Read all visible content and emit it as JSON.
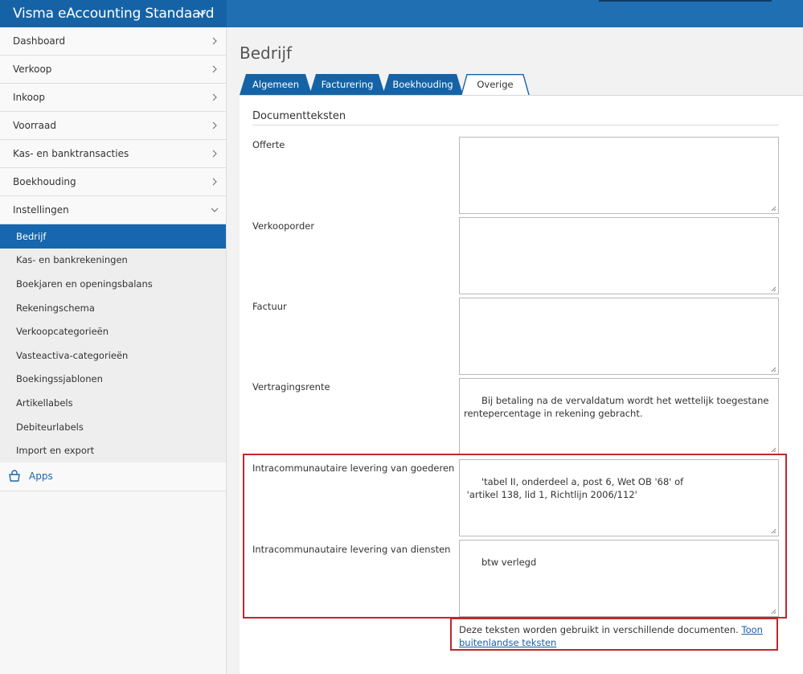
{
  "app": {
    "title": "Visma eAccounting Standaard",
    "brand_color": "#1563a6",
    "accent_color": "#1667ad",
    "highlight_color": "#c0272d"
  },
  "sidebar": {
    "items": [
      {
        "label": "Dashboard",
        "icon": "chevron-right-icon"
      },
      {
        "label": "Verkoop",
        "icon": "chevron-right-icon"
      },
      {
        "label": "Inkoop",
        "icon": "chevron-right-icon"
      },
      {
        "label": "Voorraad",
        "icon": "chevron-right-icon"
      },
      {
        "label": "Kas- en banktransacties",
        "icon": "chevron-right-icon"
      },
      {
        "label": "Boekhouding",
        "icon": "chevron-right-icon"
      },
      {
        "label": "Instellingen",
        "icon": "chevron-down-icon"
      }
    ],
    "sub_items": [
      {
        "label": "Bedrijf",
        "active": true
      },
      {
        "label": "Kas- en bankrekeningen"
      },
      {
        "label": "Boekjaren en openingsbalans"
      },
      {
        "label": "Rekeningschema"
      },
      {
        "label": "Verkoopcategorieën"
      },
      {
        "label": "Vasteactiva-categorieën"
      },
      {
        "label": "Boekingssjablonen"
      },
      {
        "label": "Artikellabels"
      },
      {
        "label": "Debiteurlabels"
      },
      {
        "label": "Import en export"
      }
    ],
    "apps_label": "Apps",
    "apps_icon": "shopping-basket-icon"
  },
  "main": {
    "page_title": "Bedrijf",
    "tabs": [
      {
        "label": "Algemeen"
      },
      {
        "label": "Facturering"
      },
      {
        "label": "Boekhouding"
      },
      {
        "label": "Overige",
        "active": true
      }
    ],
    "section_title": "Documentteksten",
    "fields": [
      {
        "label": "Offerte",
        "value": ""
      },
      {
        "label": "Verkooporder",
        "value": ""
      },
      {
        "label": "Factuur",
        "value": ""
      },
      {
        "label": "Vertragingsrente",
        "value": "Bij betaling na de vervaldatum wordt het wettelijk toegestane rentepercentage in rekening gebracht."
      },
      {
        "label": "Intracommunautaire levering van goederen",
        "value": "'tabel II, onderdeel a, post 6, Wet OB '68' of\n 'artikel 138, lid 1, Richtlijn 2006/112'"
      },
      {
        "label": "Intracommunautaire levering van diensten",
        "value": "btw verlegd"
      }
    ],
    "footnote_text": "Deze teksten worden gebruikt in verschillende documenten.",
    "footnote_link": "Toon buitenlandse teksten"
  }
}
